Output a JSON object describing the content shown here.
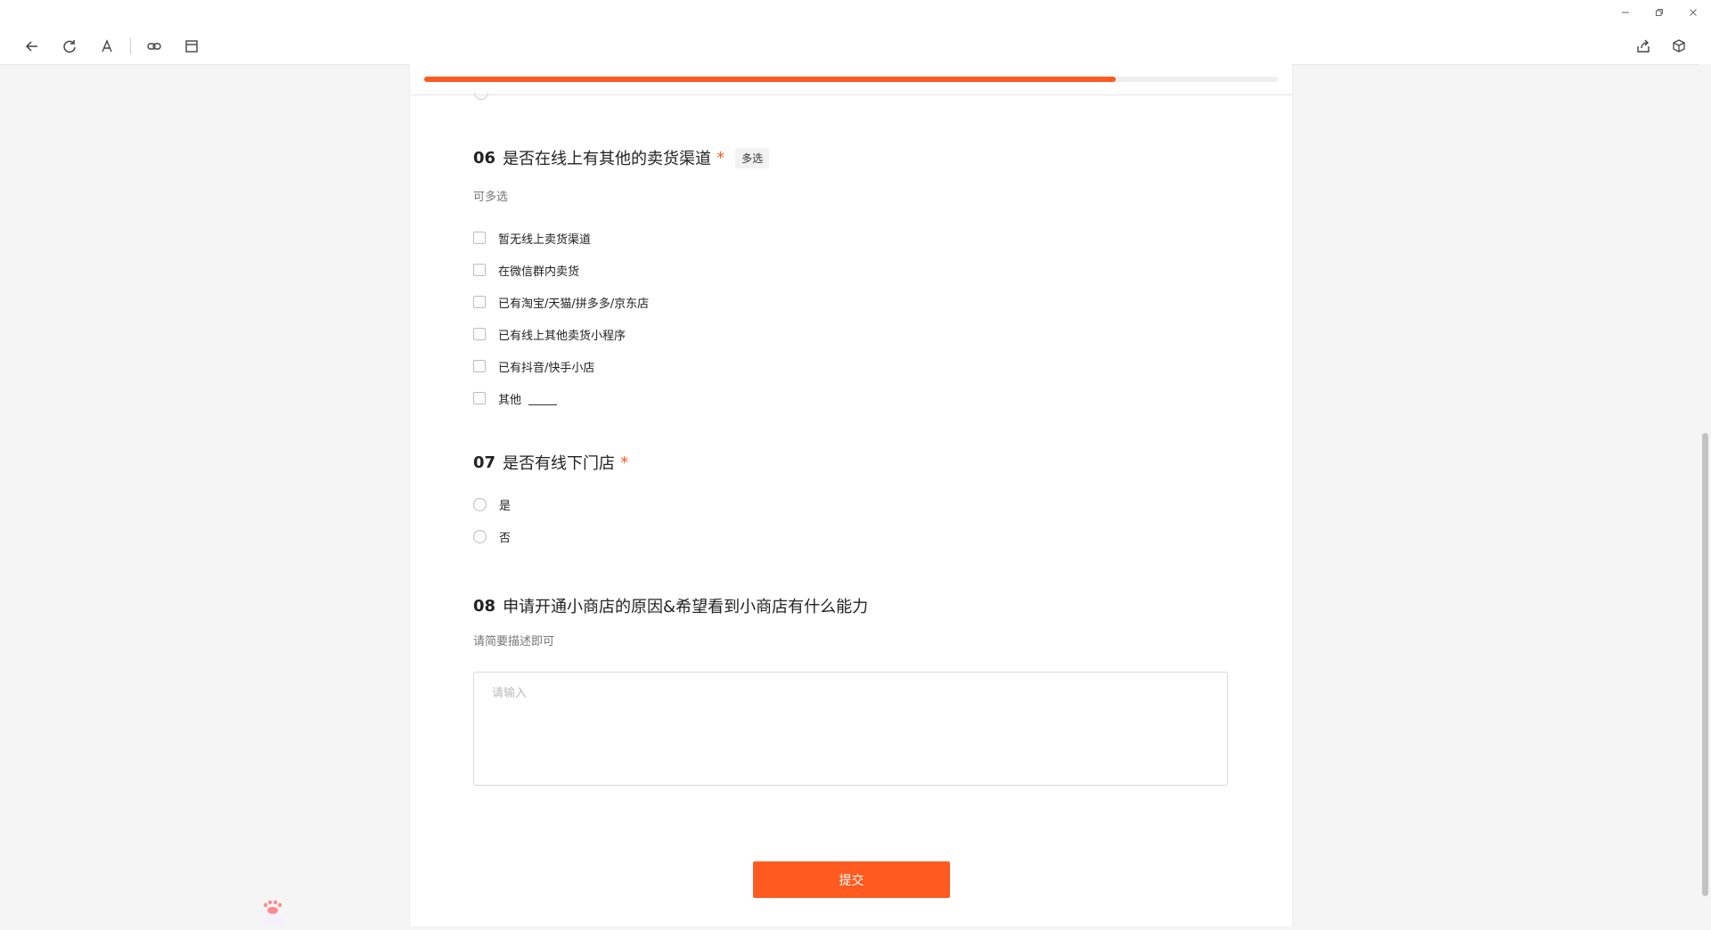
{
  "window": {
    "controls": [
      "minimize-icon",
      "restore-icon",
      "close-icon"
    ]
  },
  "toolbar": {
    "left_icons": [
      "back-icon",
      "refresh-icon",
      "font-icon",
      "link-icon",
      "layout-icon"
    ],
    "right_icons": [
      "share-icon",
      "cube-icon"
    ]
  },
  "form": {
    "progress_percent": 81,
    "accent_color": "#ff5a1f",
    "q06": {
      "num": "06",
      "title": "是否在线上有其他的卖货渠道",
      "required_mark": "*",
      "tag": "多选",
      "desc": "可多选",
      "options": [
        "暂无线上卖货渠道",
        "在微信群内卖货",
        "已有淘宝/天猫/拼多多/京东店",
        "已有线上其他卖货小程序",
        "已有抖音/快手小店",
        "其他"
      ]
    },
    "q07": {
      "num": "07",
      "title": "是否有线下门店",
      "required_mark": "*",
      "options": [
        "是",
        "否"
      ]
    },
    "q08": {
      "num": "08",
      "title": "申请开通小商店的原因&希望看到小商店有什么能力",
      "desc": "请简要描述即可",
      "placeholder": "请输入"
    },
    "submit_label": "提交"
  }
}
